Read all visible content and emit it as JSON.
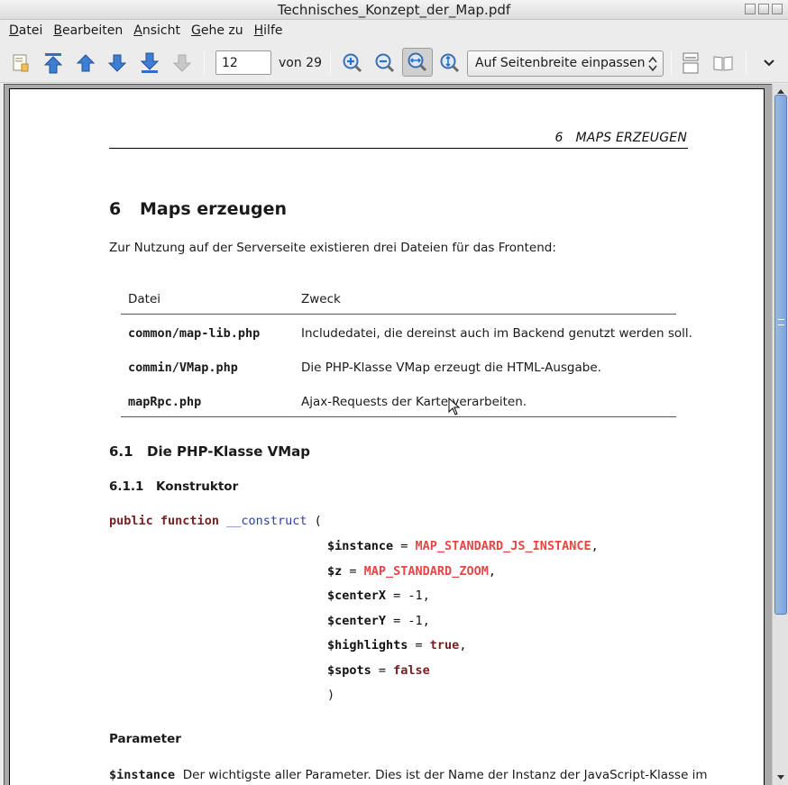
{
  "window": {
    "title": "Technisches_Konzept_der_Map.pdf"
  },
  "menu": [
    {
      "label": "Datei"
    },
    {
      "label": "Bearbeiten"
    },
    {
      "label": "Ansicht"
    },
    {
      "label": "Gehe zu"
    },
    {
      "label": "Hilfe"
    }
  ],
  "toolbar": {
    "page_value": "12",
    "page_total": "von 29",
    "zoom_mode": "Auf Seitenbreite einpassen"
  },
  "document": {
    "running_header": "6   MAPS ERZEUGEN",
    "section": {
      "number": "6",
      "title": "Maps erzeugen"
    },
    "intro": "Zur Nutzung auf der Serverseite existieren drei Dateien für das Frontend:",
    "table": {
      "headers": [
        "Datei",
        "Zweck"
      ],
      "rows": [
        {
          "file": "common/map-lib.php",
          "purpose": "Includedatei, die dereinst auch im Backend genutzt werden soll."
        },
        {
          "file": "commin/VMap.php",
          "purpose": "Die PHP-Klasse VMap erzeugt die HTML-Ausgabe."
        },
        {
          "file": "mapRpc.php",
          "purpose": "Ajax-Requests der Karte verarbeiten."
        }
      ]
    },
    "subsection": {
      "number": "6.1",
      "title": "Die PHP-Klasse VMap"
    },
    "subsubsection": {
      "number": "6.1.1",
      "title": "Konstruktor"
    },
    "code": {
      "kw_public": "public",
      "kw_function": "function",
      "fn_name": "__construct",
      "open_paren": "(",
      "params": [
        {
          "name": "$instance",
          "op": " = ",
          "value": "MAP_STANDARD_JS_INSTANCE",
          "kind": "const",
          "trail": ","
        },
        {
          "name": "$z",
          "op": " = ",
          "value": "MAP_STANDARD_ZOOM",
          "kind": "const",
          "trail": ","
        },
        {
          "name": "$centerX",
          "op": " = ",
          "value": "-1",
          "kind": "plain",
          "trail": ","
        },
        {
          "name": "$centerY",
          "op": " = ",
          "value": "-1",
          "kind": "plain",
          "trail": ","
        },
        {
          "name": "$highlights",
          "op": " = ",
          "value": "true",
          "kind": "kw",
          "trail": ","
        },
        {
          "name": "$spots",
          "op": " = ",
          "value": "false",
          "kind": "kw",
          "trail": ""
        }
      ],
      "close_paren": ")"
    },
    "param_heading": "Parameter",
    "param_first": {
      "name": "$instance",
      "text": "Der wichtigste aller Parameter. Dies ist der Name der Instanz der JavaScript-Klasse im"
    }
  },
  "colors": {
    "keyword": "#7a1f1f",
    "function": "#2a3fa8",
    "constant": "#e64646",
    "toolbar_arrow": "#2f6fc4"
  }
}
